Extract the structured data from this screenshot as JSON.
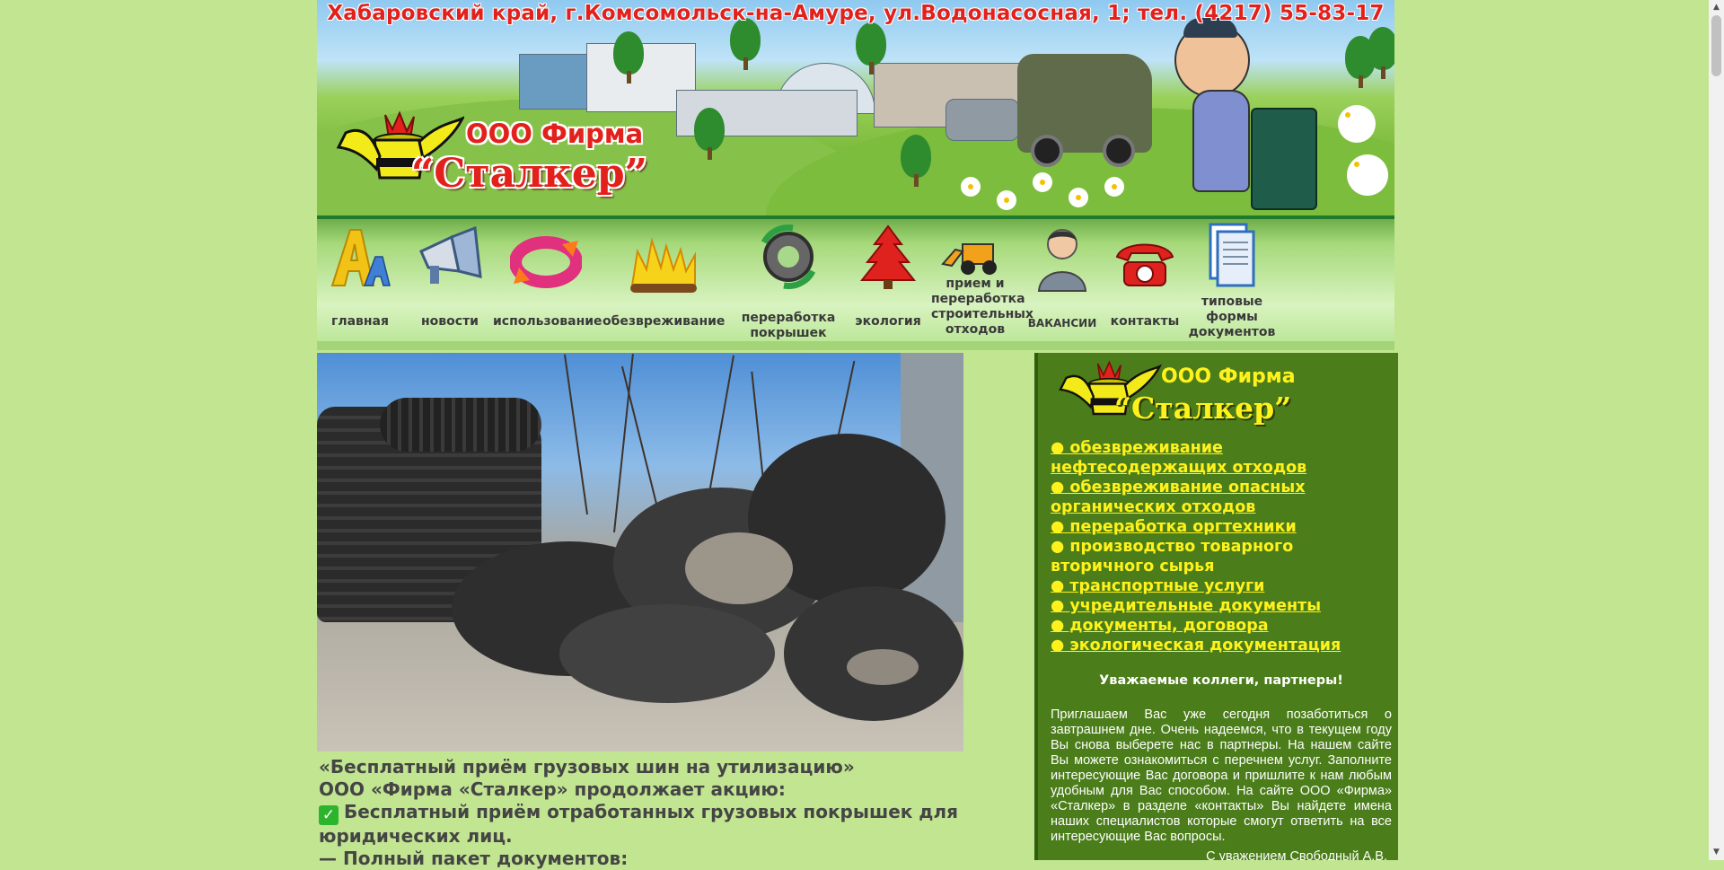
{
  "header": {
    "address": "Хабаровский край, г.Комсомольск-на-Амуре, ул.Водонасосная, 1; тел. (4217) 55-83-17",
    "company_line1": "ООО Фирма",
    "company_line2": "“Сталкер”"
  },
  "nav": {
    "items": [
      {
        "label": "главная",
        "icon": "font-letters-icon"
      },
      {
        "label": "новости",
        "icon": "megaphone-icon"
      },
      {
        "label": "использование",
        "icon": "recycle-arrows-icon"
      },
      {
        "label": "обезвреживание",
        "icon": "fire-icon"
      },
      {
        "label": "переработка\nпокрышек",
        "icon": "tire-recycle-icon"
      },
      {
        "label": "экология",
        "icon": "fir-tree-icon"
      },
      {
        "label": "прием и\nпереработка\nстроительных\nотходов",
        "icon": "loader-icon"
      },
      {
        "label": "ВАКАНСИИ",
        "icon": "person-icon"
      },
      {
        "label": "контакты",
        "icon": "telephone-icon"
      },
      {
        "label": "типовые\nформы\nдокументов",
        "icon": "documents-icon"
      }
    ]
  },
  "article": {
    "line1": "«Бесплатный приём грузовых шин на утилизацию»",
    "line2": "ООО «Фирма «Сталкер» продолжает акцию:",
    "line3": "Бесплатный приём отработанных грузовых покрышек для юридических лиц.",
    "line4": "— Полный пакет документов:"
  },
  "sidebar": {
    "logo_line1": "ООО Фирма",
    "logo_line2": "“Сталкер”",
    "services": [
      "● обезвреживание нефтесодержащих отходов",
      "● обезвреживание опасных органических отходов",
      "● переработка оргтехники",
      "● производство товарного вторичного сырья",
      "● транспортные услуги",
      "● учредительные документы",
      "● документы, договора",
      "● экологическая документация"
    ],
    "greeting": "Уважаемые коллеги, партнеры!",
    "text": "Приглашаем Вас уже сегодня позаботиться о завтрашнем дне. Очень надеемся, что в текущем году Вы снова выберете нас в партнеры. На нашем сайте Вы можете ознакомиться с перечнем услуг. Заполните интересующие Вас договора и пришлите к нам любым удобным для Вас способом. На сайте ООО «Фирма» «Сталкер» в разделе «контакты» Вы найдете имена наших специалистов которые смогут ответить на все интересующие Вас вопросы.",
    "signature": "С уважением Свободный А.В."
  },
  "colors": {
    "page_bg": "#c2e592",
    "accent_red": "#e2211c",
    "sidebar_bg": "#4b7d1a",
    "sidebar_link": "#fff21c"
  }
}
